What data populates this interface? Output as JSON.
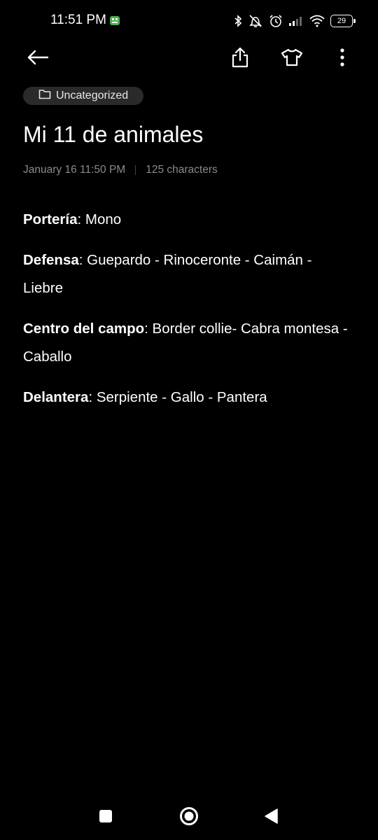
{
  "status_bar": {
    "time": "11:51 PM",
    "battery_level": "29",
    "icons": [
      "app-notification-icon",
      "bluetooth-icon",
      "vibrate-off-icon",
      "alarm-icon",
      "signal-icon",
      "wifi-icon",
      "battery-icon"
    ]
  },
  "toolbar": {
    "icons": [
      "back-arrow-icon",
      "share-icon",
      "theme-shirt-icon",
      "more-vert-icon"
    ]
  },
  "note": {
    "folder": "Uncategorized",
    "title": "Mi 11 de animales",
    "date": "January 16 11:50 PM",
    "characters": "125 characters",
    "paragraphs": [
      {
        "label": "Portería",
        "text": ": Mono"
      },
      {
        "label": "Defensa",
        "text": ": Guepardo - Rinoceronte - Caimán - Liebre"
      },
      {
        "label": "Centro del campo",
        "text": ": Border collie- Cabra montesa - Caballo"
      },
      {
        "label": "Delantera",
        "text": ": Serpiente - Gallo - Pantera"
      }
    ]
  },
  "navigation_bar": {
    "icons": [
      "recents-square-icon",
      "home-circle-icon",
      "back-triangle-icon"
    ]
  },
  "colors": {
    "background": "#000000",
    "text": "#ffffff",
    "meta_text": "#8a8a8a",
    "chip_background": "#2a2a2a"
  }
}
